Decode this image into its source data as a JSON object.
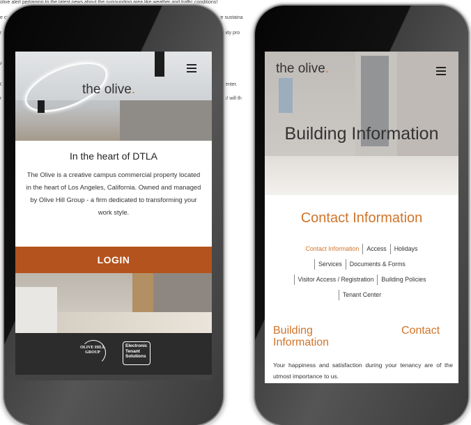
{
  "background_doc": {
    "line1": "olive alert pertaining to the latest news about the surrounding area like weather and traffic conditions!",
    "line2_left": "e cu",
    "line2_right": "like sustaina",
    "line3_left": "n",
    "line3_right": "affinity pro",
    "line4_left": "Ac",
    "line5_right": "Center.",
    "line5_left": "Ol",
    "line6_left": "nt",
    "line6_right": "es! will th"
  },
  "left_phone": {
    "logo": "the olive",
    "logo_dot": ".",
    "menu_icon": "hamburger-menu-icon",
    "heading": "In the heart of DTLA",
    "description": "The Olive is a creative campus commercial property located in the heart of Los Angeles, California. Owned and managed by Olive Hill Group - a firm dedicated to transforming your work style.",
    "login_label": "LOGIN",
    "footer_logo1": "OLIVE HILL GROUP",
    "footer_logo1_small": "Managed by",
    "footer_logo2": "Electronic Tenant Solutions"
  },
  "right_phone": {
    "logo": "the olive",
    "logo_dot": ".",
    "menu_icon": "hamburger-menu-icon",
    "hero_title": "Building Information",
    "section_title": "Contact Information",
    "nav_links": [
      "Contact Information",
      "Access",
      "Holidays",
      "Services",
      "Documents & Forms",
      "Visitor Access / Registration",
      "Building Policies",
      "Tenant Center"
    ],
    "building_info_heading_line1": "Building",
    "building_info_heading_line2": "Information",
    "contact_heading": "Contact",
    "body_text": "Your happiness and satisfaction during your tenancy are of the utmost importance to us."
  },
  "colors": {
    "accent": "#d0742a",
    "login_button": "#b4531d",
    "footer": "#2c2c2c"
  }
}
